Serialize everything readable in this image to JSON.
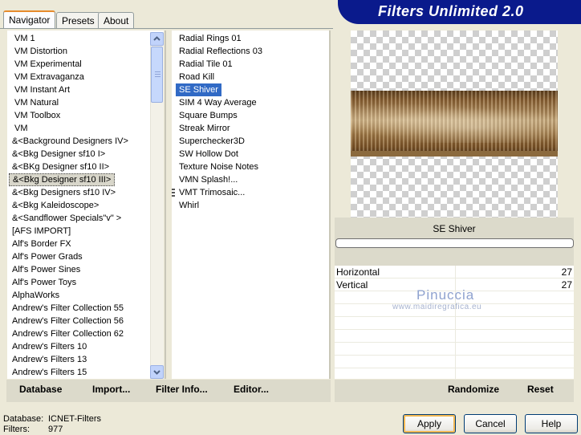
{
  "tabs": [
    {
      "label": "Navigator",
      "active": true
    },
    {
      "label": "Presets",
      "active": false
    },
    {
      "label": "About",
      "active": false
    }
  ],
  "banner": {
    "title": "Filters Unlimited 2.0"
  },
  "categories": [
    "VM 1",
    "VM Distortion",
    "VM Experimental",
    "VM Extravaganza",
    "VM Instant Art",
    "VM Natural",
    "VM Toolbox",
    "VM",
    "&<Background Designers IV>",
    "&<Bkg Designer sf10 I>",
    "&<BKg Designer sf10 II>",
    "&<Bkg Designer sf10 III>",
    "&<Bkg Designers sf10 IV>",
    "&<Bkg Kaleidoscope>",
    "&<Sandflower Specials\"v\" >",
    "[AFS IMPORT]",
    "Alf's Border FX",
    "Alf's Power Grads",
    "Alf's Power Sines",
    "Alf's Power Toys",
    "AlphaWorks",
    "Andrew's Filter Collection 55",
    "Andrew's Filter Collection 56",
    "Andrew's Filter Collection 62",
    "Andrew's Filters 10",
    "Andrew's Filters 13",
    "Andrew's Filters 15"
  ],
  "selected_category": "&<Bkg Designer sf10 III>",
  "filters": [
    "Radial  Rings 01",
    "Radial Reflections 03",
    "Radial Tile 01",
    "Road Kill",
    "SE Shiver",
    "SIM 4 Way Average",
    "Square Bumps",
    "Streak Mirror",
    "Superchecker3D",
    "SW Hollow Dot",
    "Texture Noise Notes",
    "VMN Splash!...",
    "VMT Trimosaic...",
    "Whirl"
  ],
  "selected_filter": "SE Shiver",
  "preview": {
    "filter_name": "SE Shiver"
  },
  "params": [
    {
      "label": "Horizontal",
      "value": "27"
    },
    {
      "label": "Vertical",
      "value": "27"
    }
  ],
  "watermark": {
    "name": "Pinuccia",
    "site": "www.maidiregrafica.eu"
  },
  "toolbar": {
    "database": "Database",
    "import": "Import...",
    "filter_info": "Filter Info...",
    "editor": "Editor...",
    "randomize": "Randomize",
    "reset": "Reset"
  },
  "status": {
    "database_label": "Database:",
    "database_value": "ICNET-Filters",
    "filters_label": "Filters:",
    "filters_value": "977"
  },
  "buttons": {
    "apply": "Apply",
    "cancel": "Cancel",
    "help": "Help"
  },
  "colors": {
    "selection": "#316ac5",
    "banner": "#0a1a8c",
    "default_border": "#f2b854"
  }
}
